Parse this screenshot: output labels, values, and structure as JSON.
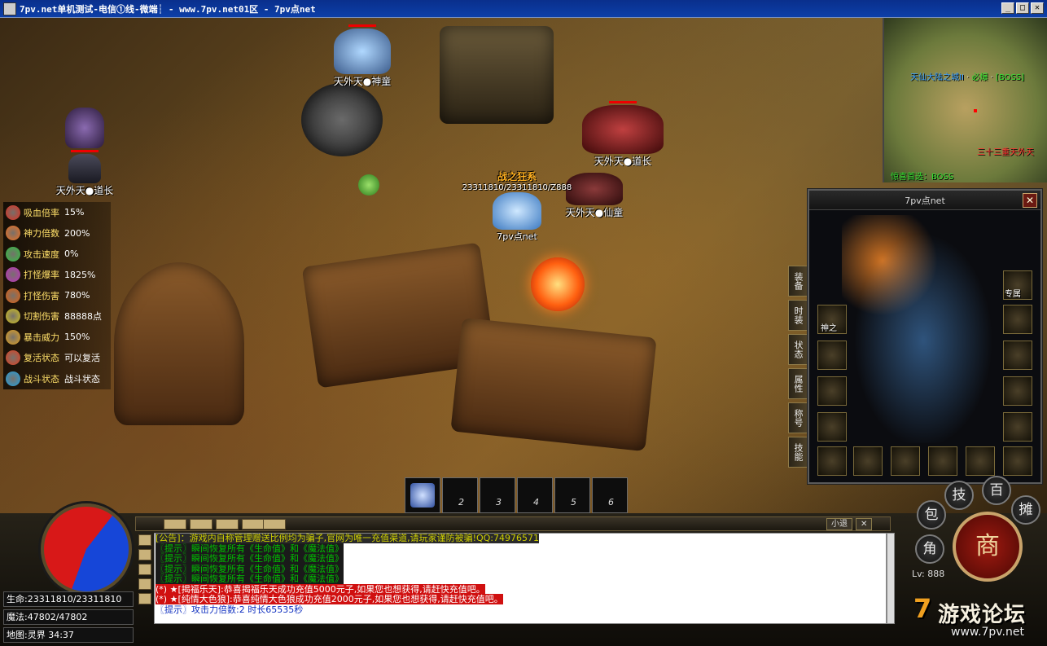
{
  "window": {
    "title": "7pv.net单机测试-电信①线-微端┆ - www.7pv.net01区 - 7pv点net",
    "buttons": [
      "_",
      "□",
      "✕"
    ]
  },
  "scene": {
    "npcs": [
      {
        "name": "天外天●神童"
      },
      {
        "name": "天外天●道长"
      },
      {
        "name": "天外天●道长"
      },
      {
        "name": "天外天●仙童"
      }
    ],
    "player": {
      "name": "7pv点net",
      "hp_text": "23311810/23311810/Z888",
      "title": "战之狂系"
    }
  },
  "stats": [
    {
      "label": "吸血倍率",
      "value": "15%",
      "icon": "blood-drop-icon",
      "color": "#e03020"
    },
    {
      "label": "神力倍数",
      "value": "200%",
      "icon": "power-flame-icon",
      "color": "#f07020"
    },
    {
      "label": "攻击速度",
      "value": "0%",
      "icon": "speed-icon",
      "color": "#30c040"
    },
    {
      "label": "打怪爆率",
      "value": "1825%",
      "icon": "skull-icon",
      "color": "#c030c0"
    },
    {
      "label": "打怪伤害",
      "value": "780%",
      "icon": "target-icon",
      "color": "#e06010"
    },
    {
      "label": "切割伤害",
      "value": "88888点",
      "icon": "blade-icon",
      "color": "#d0c020"
    },
    {
      "label": "暴击威力",
      "value": "150%",
      "icon": "crit-icon",
      "color": "#e0a020"
    },
    {
      "label": "复活状态",
      "value": "可以复活",
      "icon": "revive-icon",
      "color": "#e04020"
    },
    {
      "label": "战斗状态",
      "value": "战斗状态",
      "icon": "battle-icon",
      "color": "#20a0e0"
    }
  ],
  "minimap": {
    "labels": [
      {
        "text": "天仙大陆之城II",
        "color": "#3aa0ff"
      },
      {
        "text": "必爆",
        "color": "#30e030"
      },
      {
        "text": "[BOSS]",
        "color": "#30e030"
      },
      {
        "text": "三十三重天外天",
        "color": "#ff3030"
      },
      {
        "text": "惊喜首选：BOSS",
        "color": "#30e030"
      }
    ]
  },
  "equip_panel": {
    "title": "7pv点net",
    "close": "✕",
    "tabs": [
      "装备",
      "时装",
      "状态",
      "属性",
      "称号",
      "技能"
    ],
    "slot_labels": [
      "神之",
      "专属"
    ]
  },
  "skillbar": {
    "slots": [
      "",
      "2",
      "3",
      "4",
      "5",
      "6"
    ]
  },
  "hud": {
    "hp": "生命:23311810/23311810",
    "mp": "魔法:47802/47802",
    "map": "地图:灵界 34:37",
    "level": "Lv: 888",
    "buttons": {
      "skill": "技",
      "bag": "包",
      "role": "角",
      "stall": "摊",
      "shop": "商",
      "other": "百"
    },
    "toolbar": {
      "small": "小退",
      "close": "✕"
    }
  },
  "chat": [
    {
      "text": "[公告]：游戏内自称管理赠送比例均为骗子,官网为唯一充值渠道,请玩家谨防被骗!QQ:74976571",
      "color": "#d0d000",
      "bg": "#2a2a2a"
    },
    {
      "text": "〖提示〗瞬间恢复所有《生命值》和《魔法值》",
      "color": "#00c000",
      "bg": "#1a1a1a"
    },
    {
      "text": "〖提示〗瞬间恢复所有《生命值》和《魔法值》",
      "color": "#00c000",
      "bg": "#1a1a1a"
    },
    {
      "text": "〖提示〗瞬间恢复所有《生命值》和《魔法值》",
      "color": "#00c000",
      "bg": "#1a1a1a"
    },
    {
      "text": "〖提示〗瞬间恢复所有《生命值》和《魔法值》",
      "color": "#00c000",
      "bg": "#1a1a1a"
    },
    {
      "text": "(*) ★[揭福乐天]:恭喜揭福乐天成功充值5000元子,如果您也想获得,请赶快充值吧。",
      "color": "#ffffff",
      "bg": "#d01010"
    },
    {
      "text": "(*) ★[纯情大色狼]:恭喜纯情大色狼成功充值2000元子,如果您也想获得,请赶快充值吧。",
      "color": "#ffffff",
      "bg": "#d01010"
    },
    {
      "text": "〖提示〗攻击力倍数:2 时长65535秒",
      "color": "#1030c0",
      "bg": "#ffffff"
    }
  ],
  "logo": {
    "prefix": "7",
    "name": "游戏论坛",
    "url": "www.7pv.net"
  }
}
